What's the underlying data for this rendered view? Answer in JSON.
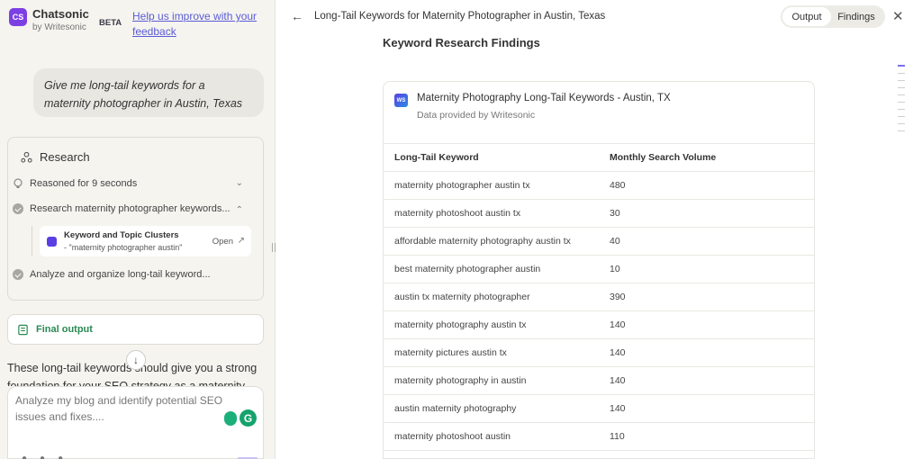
{
  "app": {
    "name": "Chatsonic",
    "by": "by Writesonic",
    "logo": "CS",
    "badge": "BETA",
    "help_link": "Help us improve with your feedback"
  },
  "chat": {
    "user_message": "Give me long-tail keywords for a maternity photographer in Austin, Texas",
    "research": {
      "title": "Research",
      "steps": [
        {
          "label": "Reasoned for 9 seconds"
        },
        {
          "label": "Research maternity photographer keywords..."
        },
        {
          "label": "Analyze and organize long-tail keyword..."
        }
      ],
      "tool": {
        "title": "Keyword and Topic Clusters",
        "query": "- \"maternity photographer austin\"",
        "open": "Open"
      }
    },
    "final_output": "Final output",
    "answer_preview": "These long-tail keywords should give you a strong foundation for your SEO strategy as a maternity",
    "composer_placeholder": "Analyze my blog and identify potential SEO issues and fixes....",
    "grammarly_letter": "G"
  },
  "panel": {
    "title": "Long-Tail Keywords for Maternity Photographer in Austin, Texas",
    "tabs": [
      "Output",
      "Findings"
    ],
    "active_tab": "Output",
    "section_heading": "Keyword Research Findings",
    "card": {
      "logo": "WS",
      "title": "Maternity Photography Long-Tail Keywords - Austin, TX",
      "subtitle": "Data provided by Writesonic"
    },
    "table": {
      "headers": [
        "Long-Tail Keyword",
        "Monthly Search Volume"
      ],
      "rows": [
        [
          "maternity photographer austin tx",
          "480"
        ],
        [
          "maternity photoshoot austin tx",
          "30"
        ],
        [
          "affordable maternity photography austin tx",
          "40"
        ],
        [
          "best maternity photographer austin",
          "10"
        ],
        [
          "austin tx maternity photographer",
          "390"
        ],
        [
          "maternity photography austin tx",
          "140"
        ],
        [
          "maternity pictures austin tx",
          "140"
        ],
        [
          "maternity photography in austin",
          "140"
        ],
        [
          "austin maternity photography",
          "140"
        ],
        [
          "maternity photoshoot austin",
          "110"
        ],
        [
          "",
          ""
        ]
      ]
    }
  },
  "colors": {
    "accent": "#7b3fe4",
    "link": "#5b5bd6",
    "success": "#2a8a52",
    "background_left": "#f5f4ef"
  }
}
